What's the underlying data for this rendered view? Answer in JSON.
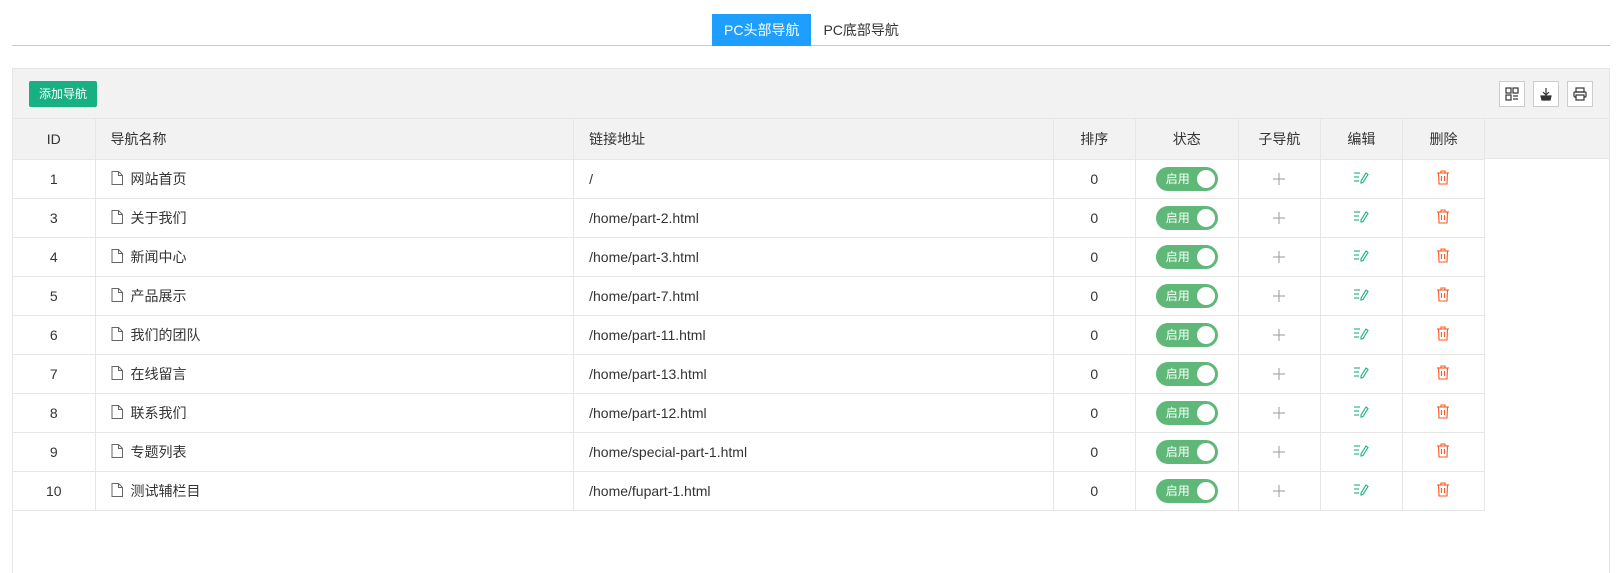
{
  "tabs": [
    {
      "label": "PC头部导航",
      "active": true
    },
    {
      "label": "PC底部导航",
      "active": false
    }
  ],
  "toolbar": {
    "add_label": "添加导航",
    "icons": [
      "columns-icon",
      "export-icon",
      "print-icon"
    ]
  },
  "table": {
    "headers": {
      "id": "ID",
      "name": "导航名称",
      "link": "链接地址",
      "sort": "排序",
      "status": "状态",
      "child": "子导航",
      "edit": "编辑",
      "delete": "删除"
    },
    "rows": [
      {
        "id": "1",
        "name": "网站首页",
        "link": "/",
        "sort": "0",
        "status": "启用"
      },
      {
        "id": "3",
        "name": "关于我们",
        "link": "/home/part-2.html",
        "sort": "0",
        "status": "启用"
      },
      {
        "id": "4",
        "name": "新闻中心",
        "link": "/home/part-3.html",
        "sort": "0",
        "status": "启用"
      },
      {
        "id": "5",
        "name": "产品展示",
        "link": "/home/part-7.html",
        "sort": "0",
        "status": "启用"
      },
      {
        "id": "6",
        "name": "我们的团队",
        "link": "/home/part-11.html",
        "sort": "0",
        "status": "启用"
      },
      {
        "id": "7",
        "name": "在线留言",
        "link": "/home/part-13.html",
        "sort": "0",
        "status": "启用"
      },
      {
        "id": "8",
        "name": "联系我们",
        "link": "/home/part-12.html",
        "sort": "0",
        "status": "启用"
      },
      {
        "id": "9",
        "name": "专题列表",
        "link": "/home/special-part-1.html",
        "sort": "0",
        "status": "启用"
      },
      {
        "id": "10",
        "name": "测试辅栏目",
        "link": "/home/fupart-1.html",
        "sort": "0",
        "status": "启用"
      }
    ]
  },
  "colors": {
    "tab_active": "#1e9fff",
    "add_button": "#16b083",
    "toggle_on": "#5fb878",
    "edit_icon": "#16b083",
    "delete_icon": "#ff5722"
  }
}
